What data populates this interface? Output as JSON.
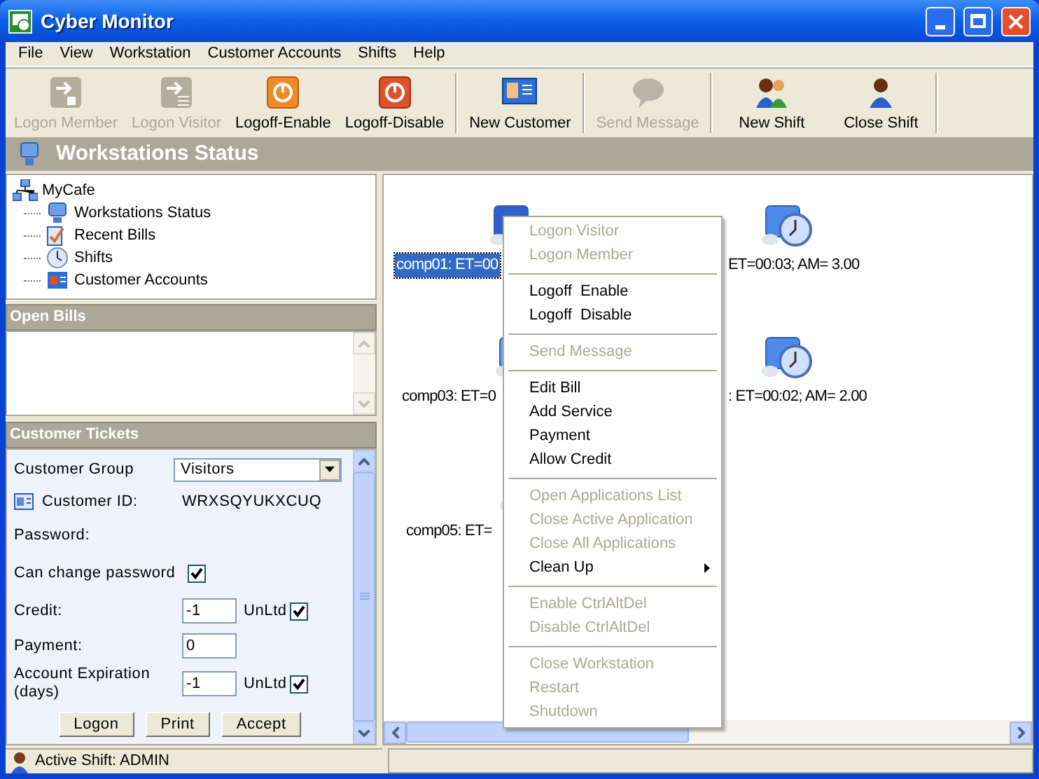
{
  "window": {
    "title": "Cyber Monitor"
  },
  "menu": [
    "File",
    "View",
    "Workstation",
    "Customer Accounts",
    "Shifts",
    "Help"
  ],
  "toolbar": [
    [
      {
        "label": "Logon Member",
        "disabled": true,
        "kind": "arrow-box"
      },
      {
        "label": "Logon Visitor",
        "disabled": true,
        "kind": "arrow-lines"
      },
      {
        "label": "Logoff-Enable",
        "disabled": false,
        "kind": "power-orange"
      },
      {
        "label": "Logoff-Disable",
        "disabled": false,
        "kind": "power-red"
      }
    ],
    [
      {
        "label": "New Customer",
        "disabled": false,
        "kind": "id-card"
      }
    ],
    [
      {
        "label": "Send Message",
        "disabled": true,
        "kind": "speech"
      }
    ],
    [
      {
        "label": "New Shift",
        "disabled": false,
        "kind": "people"
      },
      {
        "label": "Close Shift",
        "disabled": false,
        "kind": "person"
      }
    ]
  ],
  "header": "Workstations Status",
  "tree": {
    "label": "MyCafe",
    "children": [
      {
        "label": "Workstations Status",
        "kind": "monitor"
      },
      {
        "label": "Recent Bills",
        "kind": "bill"
      },
      {
        "label": "Shifts",
        "kind": "clock"
      },
      {
        "label": "Customer Accounts",
        "kind": "card"
      }
    ]
  },
  "open_bills": {
    "title": "Open Bills"
  },
  "customer_tickets": {
    "title": "Customer Tickets",
    "customer_group": {
      "label": "Customer Group",
      "value": "Visitors"
    },
    "customer_id": {
      "label": "Customer ID:",
      "value": "WRXSQYUKXCUQ"
    },
    "password": {
      "label": "Password:"
    },
    "can_change_password": {
      "label": "Can change password",
      "checked": true
    },
    "credit": {
      "label": "Credit:",
      "value": "-1",
      "unlimited_label": "UnLtd",
      "checked": true
    },
    "payment": {
      "label": "Payment:",
      "value": "0"
    },
    "account_expiration": {
      "label": "Account Expiration (days)",
      "value": "-1",
      "unlimited_label": "UnLtd",
      "checked": true
    },
    "buttons": [
      "Logon",
      "Print",
      "Accept"
    ]
  },
  "workstations": [
    {
      "label": "comp01: ET=00",
      "selected": true,
      "kind": "idle"
    },
    {
      "label": "ET=00:03; AM= 3.00",
      "selected": false,
      "kind": "busy"
    },
    {
      "label": "comp03: ET=0",
      "selected": false,
      "kind": "idle"
    },
    {
      "label": ": ET=00:02; AM= 2.00",
      "selected": false,
      "kind": "busy"
    },
    {
      "label": "comp05: ET=",
      "selected": false,
      "kind": "idle"
    }
  ],
  "context_menu": [
    {
      "kind": "item",
      "label": "Logon Visitor",
      "disabled": true
    },
    {
      "kind": "item",
      "label": "Logon Member",
      "disabled": true
    },
    {
      "kind": "separator"
    },
    {
      "kind": "item",
      "label": "Logoff  Enable",
      "disabled": false
    },
    {
      "kind": "item",
      "label": "Logoff  Disable",
      "disabled": false
    },
    {
      "kind": "separator"
    },
    {
      "kind": "item",
      "label": "Send Message",
      "disabled": true
    },
    {
      "kind": "separator"
    },
    {
      "kind": "item",
      "label": "Edit Bill",
      "disabled": false
    },
    {
      "kind": "item",
      "label": "Add Service",
      "disabled": false
    },
    {
      "kind": "item",
      "label": "Payment",
      "disabled": false
    },
    {
      "kind": "item",
      "label": "Allow Credit",
      "disabled": false
    },
    {
      "kind": "separator"
    },
    {
      "kind": "item",
      "label": "Open Applications List",
      "disabled": true
    },
    {
      "kind": "item",
      "label": "Close Active Application",
      "disabled": true
    },
    {
      "kind": "item",
      "label": "Close All Applications",
      "disabled": true
    },
    {
      "kind": "submenu",
      "label": "Clean Up",
      "disabled": false
    },
    {
      "kind": "separator"
    },
    {
      "kind": "item",
      "label": "Enable CtrlAltDel",
      "disabled": true
    },
    {
      "kind": "item",
      "label": "Disable CtrlAltDel",
      "disabled": true
    },
    {
      "kind": "separator"
    },
    {
      "kind": "item",
      "label": "Close Workstation",
      "disabled": true
    },
    {
      "kind": "item",
      "label": "Restart",
      "disabled": true
    },
    {
      "kind": "item",
      "label": "Shutdown",
      "disabled": true
    }
  ],
  "status_bar": {
    "text": "Active Shift: ADMIN"
  }
}
